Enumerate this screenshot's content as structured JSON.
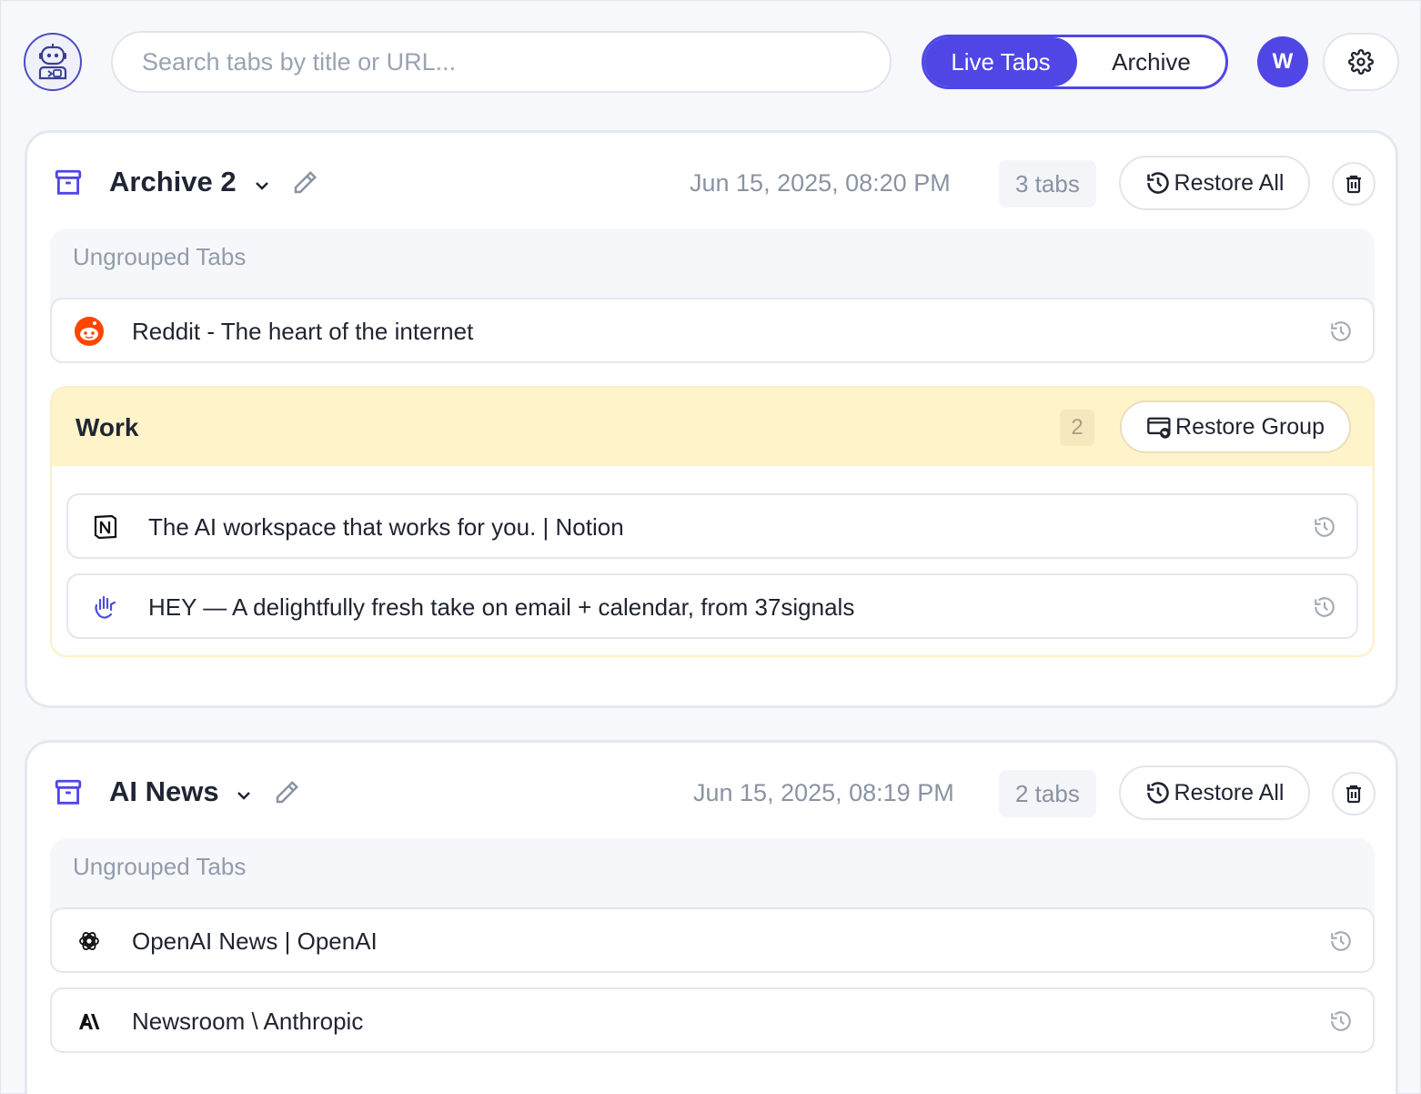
{
  "search": {
    "placeholder": "Search tabs by title or URL..."
  },
  "view_toggle": {
    "live_label": "Live Tabs",
    "archive_label": "Archive",
    "active": "Archive"
  },
  "user": {
    "initial": "W"
  },
  "colors": {
    "accent": "#4f46e5",
    "group_bg": "#fef3c9"
  },
  "archives": [
    {
      "title": "Archive 2",
      "date": "Jun 15, 2025, 08:20 PM",
      "count_label": "3 tabs",
      "restore_all_label": "Restore All",
      "ungrouped_label": "Ungrouped Tabs",
      "ungrouped_tabs": [
        {
          "title": "Reddit - The heart of the internet",
          "icon": "reddit-icon"
        }
      ],
      "groups": [
        {
          "name": "Work",
          "count": "2",
          "restore_label": "Restore Group",
          "tabs": [
            {
              "title": "The AI workspace that works for you. | Notion",
              "icon": "notion-icon"
            },
            {
              "title": "HEY — A delightfully fresh take on email + calendar, from 37signals",
              "icon": "hey-icon"
            }
          ]
        }
      ]
    },
    {
      "title": "AI News",
      "date": "Jun 15, 2025, 08:19 PM",
      "count_label": "2 tabs",
      "restore_all_label": "Restore All",
      "ungrouped_label": "Ungrouped Tabs",
      "ungrouped_tabs": [
        {
          "title": "OpenAI News | OpenAI",
          "icon": "openai-icon"
        },
        {
          "title": "Newsroom \\ Anthropic",
          "icon": "anthropic-icon"
        }
      ]
    }
  ]
}
